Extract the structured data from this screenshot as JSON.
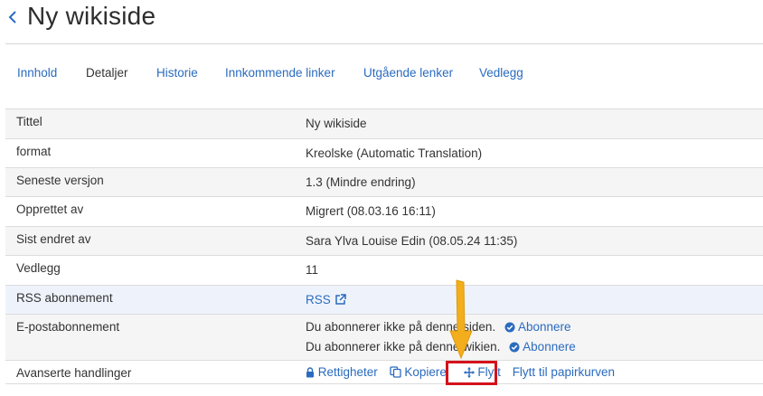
{
  "header": {
    "title": "Ny wikiside"
  },
  "tabs": [
    {
      "label": "Innhold"
    },
    {
      "label": "Detaljer"
    },
    {
      "label": "Historie"
    },
    {
      "label": "Innkommende linker"
    },
    {
      "label": "Utgående lenker"
    },
    {
      "label": "Vedlegg"
    }
  ],
  "rows": {
    "tittel": {
      "label": "Tittel",
      "value": "Ny wikiside"
    },
    "format": {
      "label": "format",
      "value": "Kreolske (Automatic Translation)"
    },
    "version": {
      "label": "Seneste versjon",
      "value": "1.3 (Mindre endring)"
    },
    "created": {
      "label": "Opprettet av",
      "value": "Migrert (08.03.16 16:11)"
    },
    "modified": {
      "label": "Sist endret av",
      "value": "Sara Ylva Louise Edin (08.05.24 11:35)"
    },
    "attachments": {
      "label": "Vedlegg",
      "value": "11"
    },
    "rss": {
      "label": "RSS abonnement",
      "link": "RSS"
    },
    "email": {
      "label": "E-postabonnement",
      "line1": "Du abonnerer ikke på denne siden.",
      "line2": "Du abonnerer ikke på denne wikien.",
      "subscribe": "Abonnere"
    },
    "advanced": {
      "label": "Avanserte handlinger",
      "permissions": "Rettigheter",
      "copy": "Kopiere",
      "move": "Flytt",
      "trash": "Flytt til papirkurven"
    }
  },
  "colors": {
    "link": "#2a6bbf",
    "highlight": "#d4111b",
    "arrow": "#f2ae1c"
  },
  "icons": [
    "chevron-left-icon",
    "external-link-icon",
    "check-circle-icon",
    "lock-icon",
    "copy-icon",
    "move-icon",
    "arrow-down-icon"
  ]
}
